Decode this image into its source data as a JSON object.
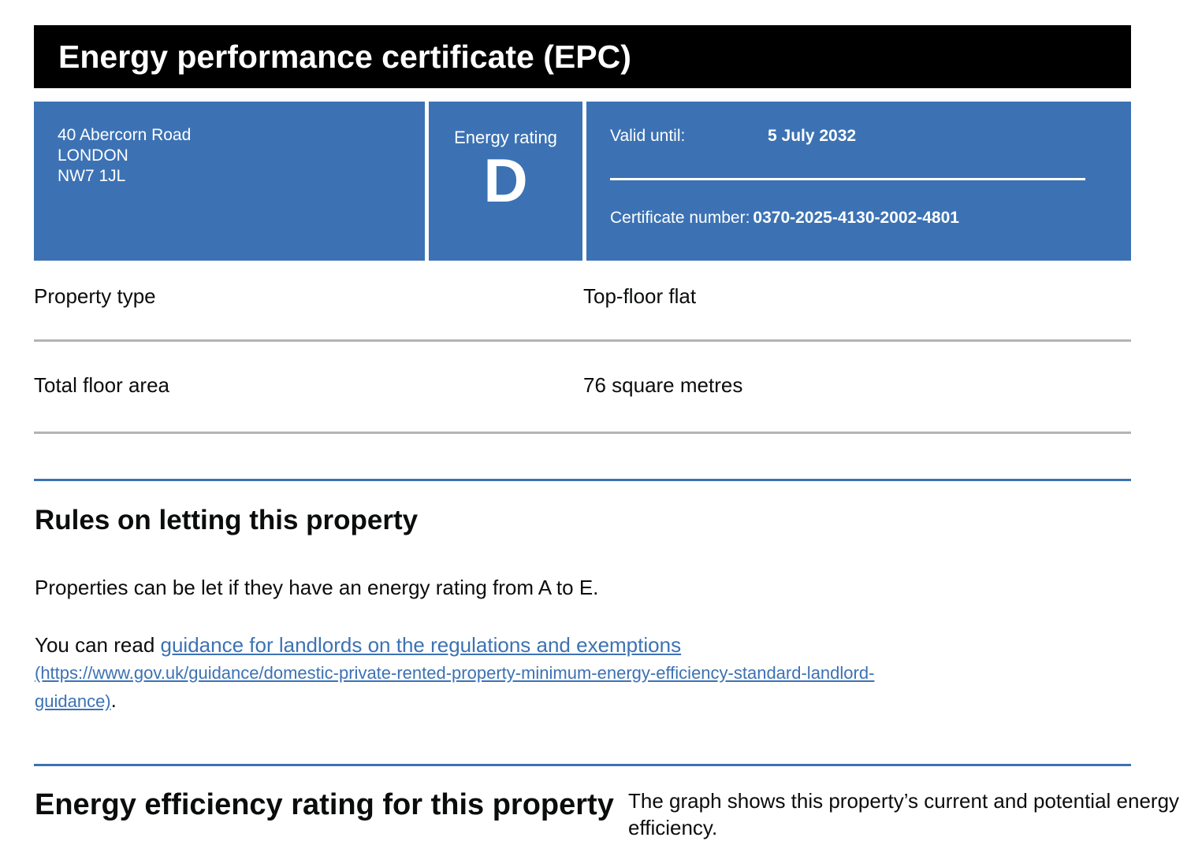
{
  "header": {
    "title": "Energy performance certificate (EPC)"
  },
  "address": {
    "line1": "40 Abercorn Road",
    "line2": "LONDON",
    "line3": "NW7 1JL"
  },
  "rating": {
    "label": "Energy rating",
    "letter": "D"
  },
  "validity": {
    "valid_label": "Valid until:",
    "valid_date": "5 July 2032",
    "certificate_label": "Certificate number:",
    "certificate_number": "0370-2025-4130-2002-4801"
  },
  "property": {
    "type_label": "Property type",
    "type_value": "Top-floor flat",
    "area_label": "Total floor area",
    "area_value": "76 square metres"
  },
  "letting": {
    "heading": "Rules on letting this property",
    "para1": "Properties can be let if they have an energy rating from A to E.",
    "para2_prefix": "You can read ",
    "link_text": "guidance for landlords on the regulations and exemptions",
    "link_url_line1": "(https://www.gov.uk/guidance/domestic-private-rented-property-minimum-energy-efficiency-standard-landlord-",
    "link_url_line2": "guidance)",
    "para2_suffix": "."
  },
  "efficiency": {
    "heading": "Energy efficiency rating for this property",
    "intro": "The graph shows this property’s current and potential energy efficiency."
  }
}
